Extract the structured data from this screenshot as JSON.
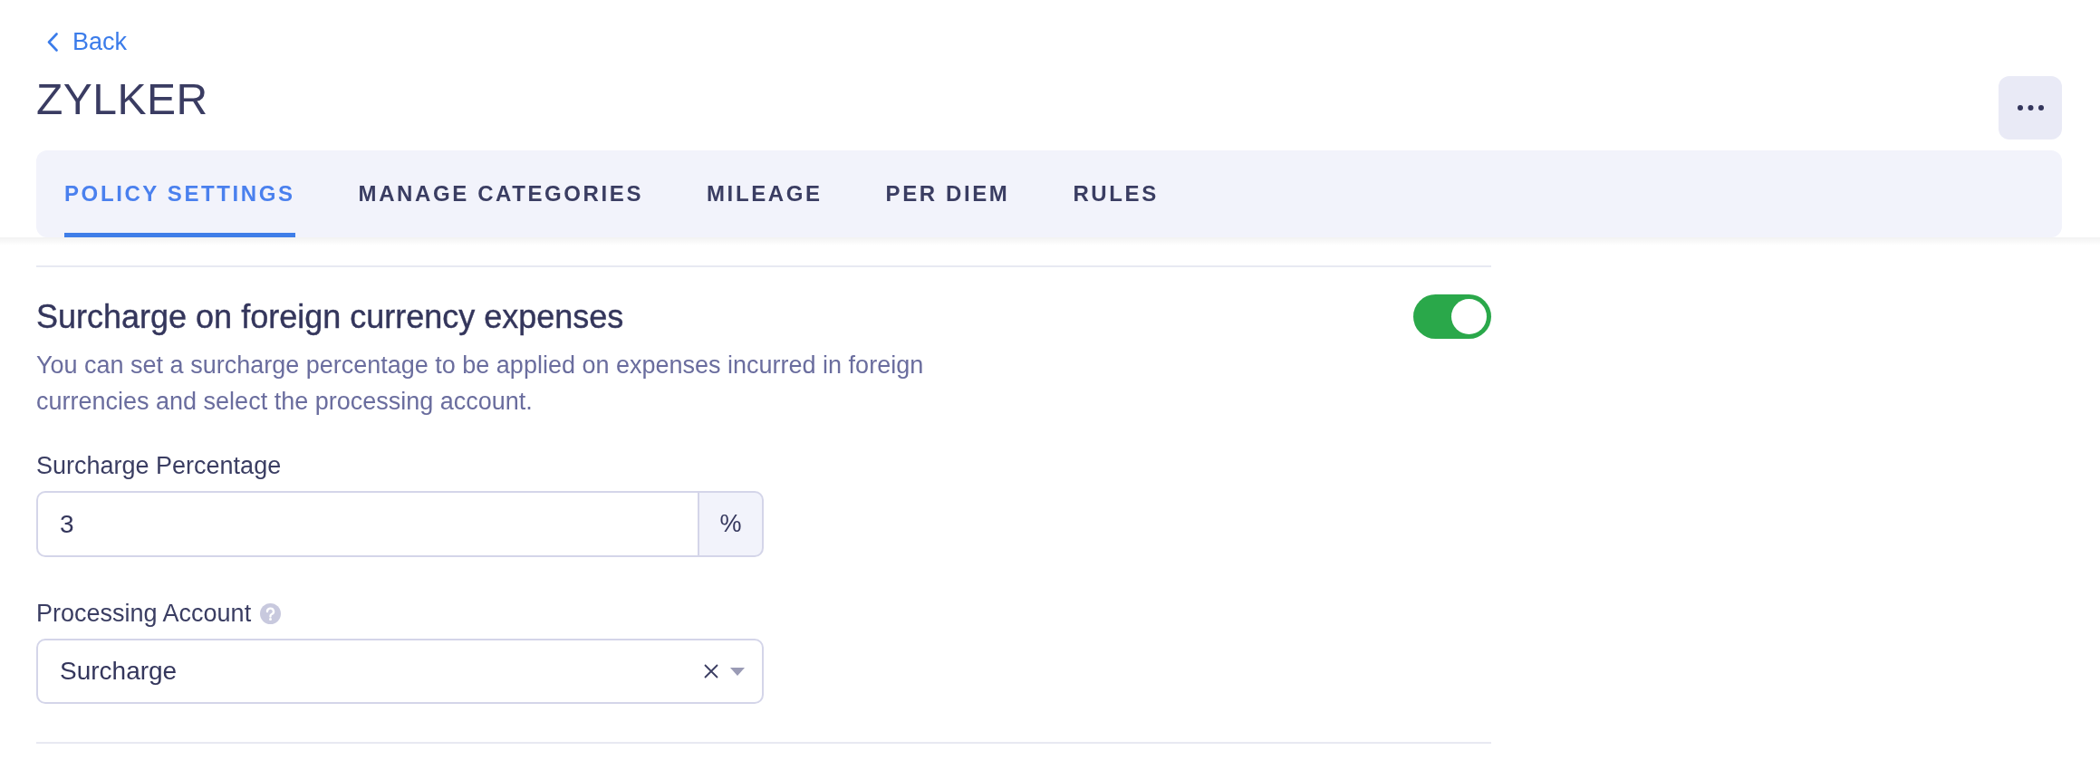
{
  "back_link": {
    "label": "Back"
  },
  "title": "ZYLKER",
  "tabs": [
    {
      "label": "POLICY SETTINGS",
      "selected": true
    },
    {
      "label": "MANAGE CATEGORIES",
      "selected": false
    },
    {
      "label": "MILEAGE",
      "selected": false
    },
    {
      "label": "PER DIEM",
      "selected": false
    },
    {
      "label": "RULES",
      "selected": false
    }
  ],
  "section": {
    "heading": "Surcharge on foreign currency expenses",
    "on": true,
    "description": "You can set a surcharge percentage to be applied on expenses incurred in foreign currencies and select the processing account.",
    "fields": [
      {
        "kind": "input",
        "label": "Surcharge Percentage",
        "help": false,
        "value": "3",
        "suffix": "%"
      },
      {
        "kind": "select",
        "label": "Processing Account",
        "help": true,
        "value": "Surcharge"
      }
    ]
  }
}
